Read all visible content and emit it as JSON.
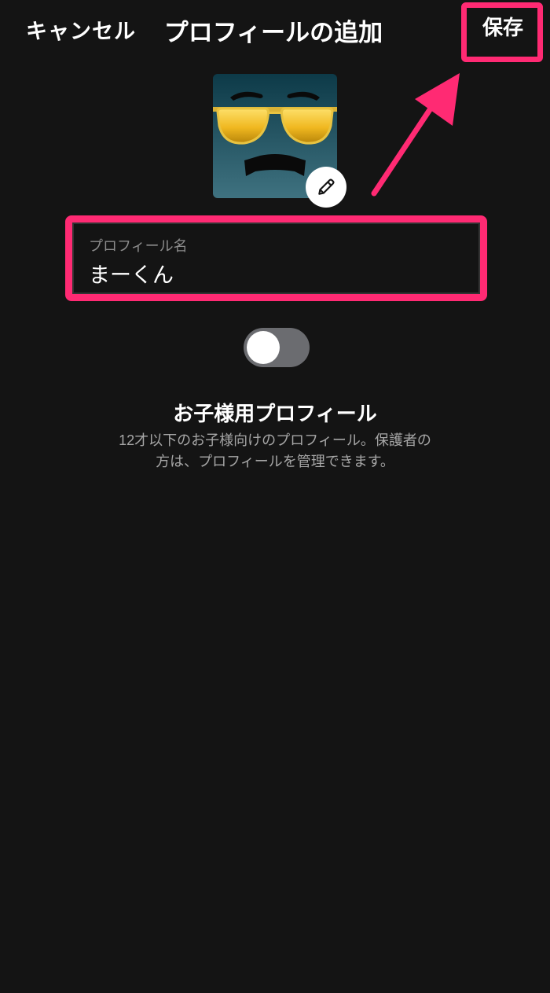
{
  "header": {
    "cancel_label": "キャンセル",
    "title": "プロフィールの追加",
    "save_label": "保存"
  },
  "profile_name": {
    "label": "プロフィール名",
    "value": "まーくん"
  },
  "kids_profile": {
    "toggle_state": "off",
    "title": "お子様用プロフィール",
    "description_line1": "12才以下のお子様向けのプロフィール。保護者の",
    "description_line2": "方は、プロフィールを管理できます。"
  },
  "icons": {
    "avatar": "sunglasses-face-avatar",
    "edit": "pencil-icon"
  },
  "colors": {
    "background": "#141414",
    "highlight": "#ff2a73",
    "toggle_off": "#6b6c70"
  }
}
